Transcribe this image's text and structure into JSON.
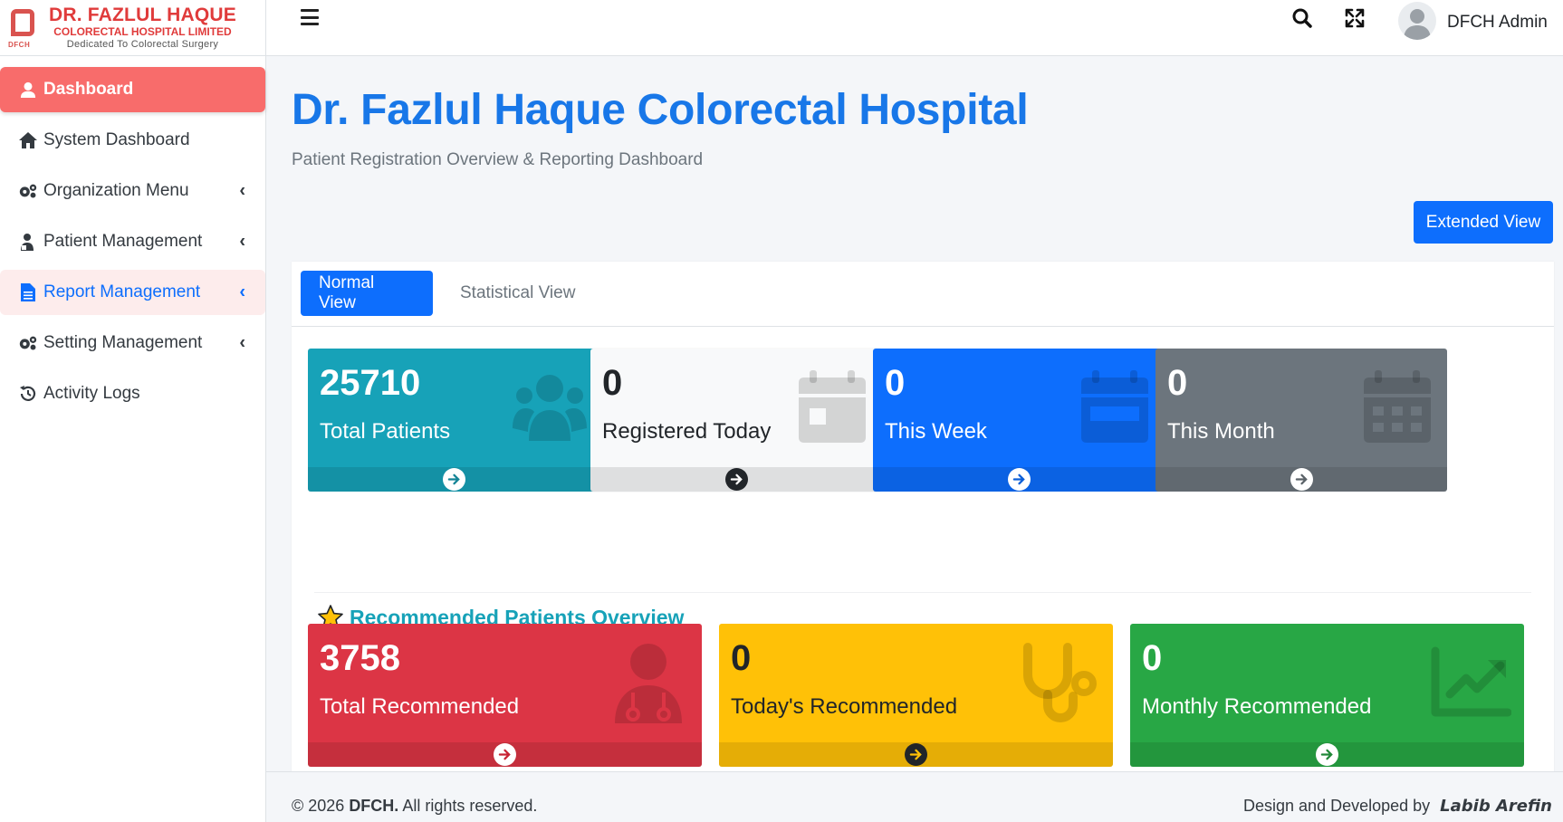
{
  "brand": {
    "line1": "DR. FAZLUL HAQUE",
    "line2": "COLORECTAL HOSPITAL LIMITED",
    "line3": "Dedicated To Colorectal Surgery",
    "abbr": "DFCH"
  },
  "sidebar": {
    "items": [
      {
        "label": "Dashboard",
        "icon": "user-icon",
        "state": "active"
      },
      {
        "label": "System Dashboard",
        "icon": "home-icon"
      },
      {
        "label": "Organization Menu",
        "icon": "gears-icon",
        "expandable": true
      },
      {
        "label": "Patient Management",
        "icon": "hospital-user-icon",
        "expandable": true
      },
      {
        "label": "Report Management",
        "icon": "file-icon",
        "expandable": true,
        "state": "highlight"
      },
      {
        "label": "Setting Management",
        "icon": "gears-icon",
        "expandable": true
      },
      {
        "label": "Activity Logs",
        "icon": "history-icon"
      }
    ]
  },
  "topbar": {
    "user_name": "DFCH Admin"
  },
  "main": {
    "title": "Dr. Fazlul Haque Colorectal Hospital",
    "subtitle": "Patient Registration Overview & Reporting Dashboard",
    "extended_view_label": "Extended View",
    "tabs": [
      {
        "label": "Normal View",
        "active": true
      },
      {
        "label": "Statistical View",
        "active": false
      }
    ],
    "stats": [
      {
        "value": "25710",
        "label": "Total Patients",
        "color": "#17a2b8",
        "icon": "users-icon"
      },
      {
        "value": "0",
        "label": "Registered Today",
        "color": "#f8f9fa",
        "icon": "calendar-day-icon"
      },
      {
        "value": "0",
        "label": "This Week",
        "color": "#0d6efd",
        "icon": "calendar-week-icon"
      },
      {
        "value": "0",
        "label": "This Month",
        "color": "#6c757d",
        "icon": "calendar-month-icon"
      }
    ],
    "recommended_heading": "Recommended Patients Overview",
    "recommended": [
      {
        "value": "3758",
        "label": "Total Recommended",
        "color": "#dc3545",
        "icon": "doctor-icon"
      },
      {
        "value": "0",
        "label": "Today's Recommended",
        "color": "#ffc107",
        "icon": "stethoscope-icon"
      },
      {
        "value": "0",
        "label": "Monthly Recommended",
        "color": "#28a745",
        "icon": "chart-line-icon"
      }
    ]
  },
  "footer": {
    "copyright_prefix": "© 2026 ",
    "copyright_brand": "DFCH.",
    "copyright_suffix": " All rights reserved.",
    "credit_prefix": "Design and Developed by",
    "credit_name": "Labib Arefin"
  }
}
